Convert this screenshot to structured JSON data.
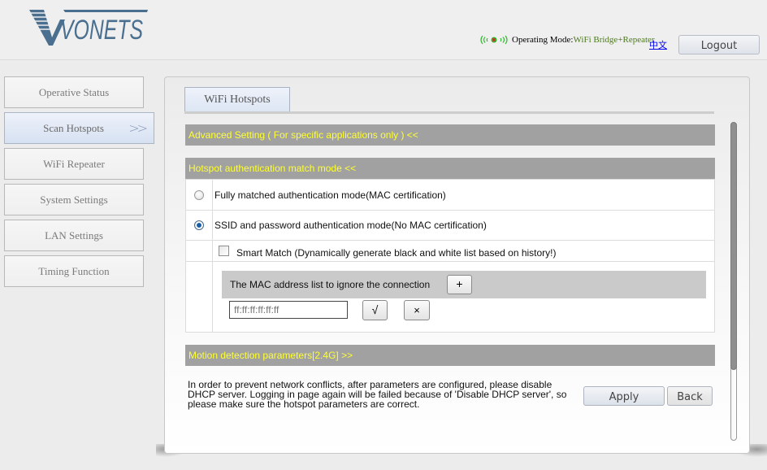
{
  "header": {
    "brand": "VONETS",
    "operating_mode_label": "Operating Mode:",
    "operating_mode_value": "WiFi Bridge+Repeater",
    "language_link": "中文",
    "logout_label": "Logout",
    "wifi_status_icon": "wifi-signal-disconnected-icon"
  },
  "sidebar": {
    "items": [
      {
        "label": "Operative Status",
        "active": false
      },
      {
        "label": "Scan Hotspots",
        "active": true,
        "indicator": ">>"
      },
      {
        "label": "WiFi Repeater",
        "active": false
      },
      {
        "label": "System Settings",
        "active": false
      },
      {
        "label": "LAN Settings",
        "active": false
      },
      {
        "label": "Timing Function",
        "active": false
      }
    ]
  },
  "main": {
    "tab_label": "WiFi Hotspots",
    "advanced_setting_header": "Advanced Setting ( For specific applications only ) <<",
    "auth_header": "Hotspot authentication match mode <<",
    "auth_options": [
      {
        "label": "Fully matched authentication mode(MAC certification)",
        "checked": false
      },
      {
        "label": "SSID and password authentication mode(No MAC certification)",
        "checked": true
      }
    ],
    "smart_match": {
      "label": "Smart Match (Dynamically generate black and white list based on history!)",
      "checked": false
    },
    "mac_list": {
      "label": "The MAC address list to ignore the connection",
      "add_label": "+",
      "input_placeholder": "ff:ff:ff:ff:ff:ff",
      "input_value": "",
      "confirm_label": "√",
      "delete_label": "×"
    },
    "motion_header": "Motion detection parameters[2.4G] >>",
    "notice": "In order to prevent network conflicts, after parameters are configured, please disable DHCP server. Logging in page again will be failed because of 'Disable DHCP server', so please make sure the hotspot parameters are correct.",
    "apply_label": "Apply",
    "back_label": "Back"
  },
  "colors": {
    "section_header_bg": "#a1a1a1",
    "section_header_text": "#ffff33",
    "mode_value": "#4c7a1c",
    "logo": "#4a6f8f"
  }
}
